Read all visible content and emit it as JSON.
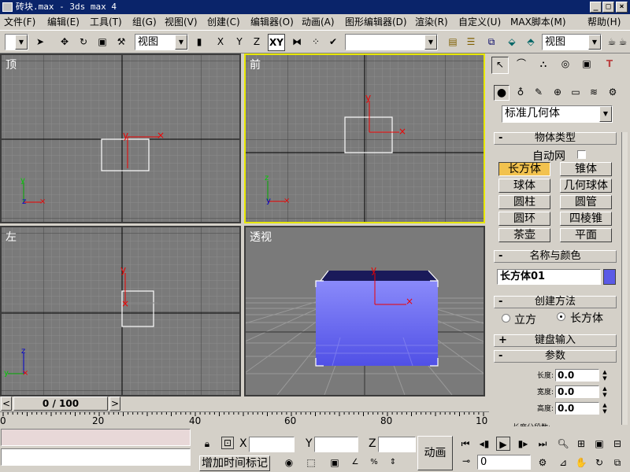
{
  "title": "砖块.max - 3ds max 4",
  "window_controls": {
    "minimize": "_",
    "maximize": "□",
    "close": "×"
  },
  "menu": [
    "文件(F)",
    "编辑(E)",
    "工具(T)",
    "组(G)",
    "视图(V)",
    "创建(C)",
    "编辑器(O)",
    "动画(A)",
    "图形编辑器(D)",
    "渲染(R)",
    "自定义(U)",
    "MAX脚本(M)",
    "帮助(H)"
  ],
  "toolbar": {
    "view_combo": "视图",
    "x_label": "X",
    "y_label": "Y",
    "z_label": "Z",
    "xy_label": "XY",
    "selection_set": "",
    "ref_coord_combo": "视图"
  },
  "viewports": {
    "top": {
      "label": "顶"
    },
    "front": {
      "label": "前"
    },
    "left": {
      "label": "左"
    },
    "perspective": {
      "label": "透视"
    }
  },
  "command_panel": {
    "category_combo": "标准几何体",
    "object_type": {
      "header": "物体类型",
      "autogrid_label": "自动网",
      "buttons": [
        "长方体",
        "锥体",
        "球体",
        "几何球体",
        "圆柱",
        "圆管",
        "圆环",
        "四棱锥",
        "茶壶",
        "平面"
      ],
      "selected": "长方体"
    },
    "name_color": {
      "header": "名称与颜色",
      "name_value": "长方体01",
      "color": "#5a5ae6"
    },
    "creation_method": {
      "header": "创建方法",
      "option_cube": "立方",
      "option_box": "长方体"
    },
    "keyboard_entry": {
      "header": "键盘输入"
    },
    "parameters": {
      "header": "参数",
      "length_label": "长度:",
      "length_value": "0.0",
      "width_label": "宽度:",
      "width_value": "0.0",
      "height_label": "高度:",
      "height_value": "0.0",
      "segments_label": "长度分段数:"
    }
  },
  "time_slider": {
    "label": "0 / 100"
  },
  "ruler_ticks": [
    "0",
    "20",
    "40",
    "60",
    "80",
    "10"
  ],
  "status": {
    "x_label": "X",
    "y_label": "Y",
    "z_label": "Z",
    "add_time_tag": "增加时间标记",
    "animate_button": "动画",
    "frame_value": "0"
  },
  "colors": {
    "title_bar": "#0a246a",
    "viewport_bg": "#7a7a7a",
    "active_viewport_border": "#e8e800",
    "selected_button": "#f2c24e",
    "box_color": "#5a5ae6"
  }
}
